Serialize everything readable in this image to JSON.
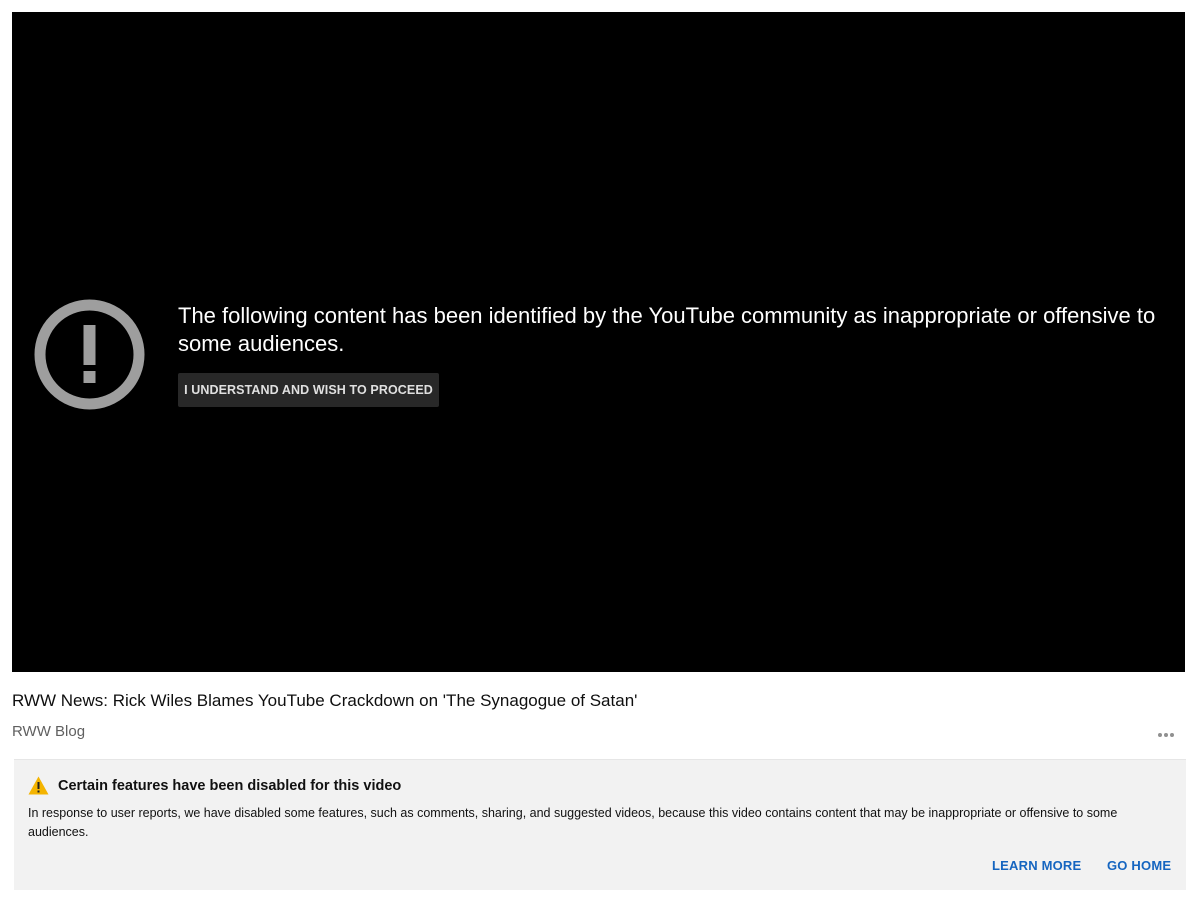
{
  "player": {
    "warning_icon": "exclamation-circle-icon",
    "message": "The following content has been identified by the YouTube community as inappropriate or offensive to some audiences.",
    "proceed_label": "I UNDERSTAND AND WISH TO PROCEED"
  },
  "video": {
    "title": "RWW News: Rick Wiles Blames YouTube Crackdown on 'The Synagogue of Satan'",
    "channel": "RWW Blog",
    "more_icon": "more-horizontal-icon"
  },
  "notice": {
    "icon": "warning-triangle-icon",
    "title": "Certain features have been disabled for this video",
    "body": "In response to user reports, we have disabled some features, such as comments, sharing, and suggested videos, because this video contains content that may be inappropriate or offensive to some audiences.",
    "learn_more_label": "LEARN MORE",
    "go_home_label": "GO HOME"
  },
  "colors": {
    "player_background": "#000000",
    "warning_icon": "#9e9e9e",
    "notice_background": "#f2f2f2",
    "warning_triangle": "#f4b400",
    "link": "#1565c0"
  }
}
